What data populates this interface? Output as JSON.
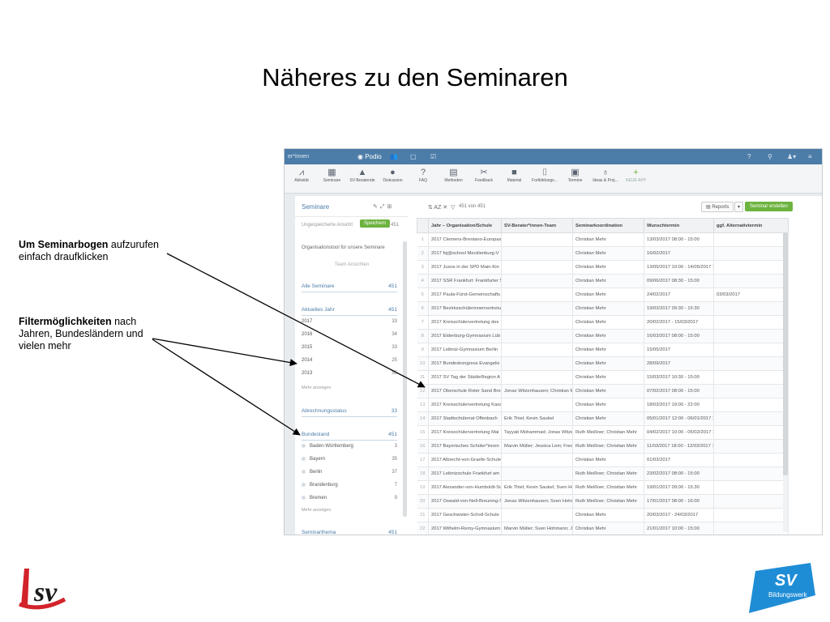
{
  "slide": {
    "title": "Näheres zu den Seminaren",
    "callout1_bold": "Um Seminarbogen",
    "callout1_rest": " aufzurufen",
    "callout1_line2": "einfach draufklicken",
    "callout2_bold": "Filtermöglichkeiten",
    "callout2_rest": " nach",
    "callout2_line2": "Jahren, Bundesländern und",
    "callout2_line3": "vielen mehr"
  },
  "app": {
    "workspace": "er*innen",
    "logo": "Podio",
    "toolbar": [
      {
        "label": "Aktivität",
        "icon": "activity-icon",
        "glyph": "⩘"
      },
      {
        "label": "Seminare",
        "icon": "grid-icon",
        "glyph": "▦"
      },
      {
        "label": "SV-Beratende",
        "icon": "cap-icon",
        "glyph": "▲"
      },
      {
        "label": "Diskussion",
        "icon": "chat-icon",
        "glyph": "●"
      },
      {
        "label": "FAQ",
        "icon": "question-icon",
        "glyph": "?"
      },
      {
        "label": "Methoden",
        "icon": "document-icon",
        "glyph": "▤"
      },
      {
        "label": "Feedback",
        "icon": "tools-icon",
        "glyph": "✂"
      },
      {
        "label": "Material",
        "icon": "folder-icon",
        "glyph": "■"
      },
      {
        "label": "Fortbildungs...",
        "icon": "book-icon",
        "glyph": "⌷"
      },
      {
        "label": "Termine",
        "icon": "calendar-icon",
        "glyph": "▣"
      },
      {
        "label": "Ideas & Proj...",
        "icon": "bulb-icon",
        "glyph": "♁"
      },
      {
        "label": "NEUE APP",
        "icon": "plus-icon",
        "glyph": "+"
      }
    ],
    "sidebar": {
      "title": "Seminare",
      "view_label": "Ungespeicherte Ansicht",
      "save_label": "Speichern",
      "view_count": "451",
      "org_label": "Organisationstool für unsere Seminare",
      "team_label": "Team Ansichten",
      "all_label": "Alle Seminare",
      "all_count": "451",
      "year_label": "Aktuelles Jahr",
      "year_count": "451",
      "years": [
        {
          "label": "2017",
          "count": "33"
        },
        {
          "label": "2016",
          "count": "34"
        },
        {
          "label": "2015",
          "count": "33"
        },
        {
          "label": "2014",
          "count": "25"
        },
        {
          "label": "2013",
          "count": "55"
        }
      ],
      "more1": "Mehr anzeigen",
      "billing_label": "Abrechnungsstatus",
      "billing_count": "33",
      "state_label": "Bundesland",
      "state_count": "451",
      "states": [
        {
          "label": "Baden-Württemberg",
          "count": "3"
        },
        {
          "label": "Bayern",
          "count": "35"
        },
        {
          "label": "Berlin",
          "count": "37"
        },
        {
          "label": "Brandenburg",
          "count": "7"
        },
        {
          "label": "Bremen",
          "count": "9"
        }
      ],
      "more2": "Mehr anzeigen",
      "theme_label": "Seminarthema",
      "theme_count": "451"
    },
    "main": {
      "count_label": "451 von 451",
      "reports_label": "Reports",
      "new_label": "Seminar erstellen",
      "columns": [
        "",
        "Jahr – Organisation/Schule",
        "SV-Berater*innen-Team",
        "Seminarkoordination",
        "Wunschtermin",
        "ggf. Alternativtermin"
      ],
      "rows": [
        [
          "1",
          "2017 Clemens-Brentano-Europas",
          "",
          "Christian Mehr",
          "13/03/2017 08:00 - 15:00",
          ""
        ],
        [
          "2",
          "2017 fsj@school Mecklenburg-V",
          "",
          "Christian Mehr",
          "16/02/2017",
          ""
        ],
        [
          "3",
          "2017 Jusos in der SPD Main-Kin",
          "",
          "Christian Mehr",
          "13/05/2017 10:00 - 14/05/2017 18",
          ""
        ],
        [
          "4",
          "2017 SSR Frankfurt: Frankfurter S",
          "",
          "Christian Mehr",
          "09/06/2017 08:30 - 15:00",
          ""
        ],
        [
          "5",
          "2017 Paula-Fürst-Gemeinschafts",
          "",
          "Christian Mehr",
          "24/02/2017",
          "03/03/2017"
        ],
        [
          "6",
          "2017 Bezirksschülerinnenvertretu",
          "",
          "Christian Mehr",
          "19/03/2017 09:30 - 15:30",
          ""
        ],
        [
          "7",
          "2017 Kreisschülervertretung des",
          "",
          "Christian Mehr",
          "20/02/2017 - 15/03/2017",
          ""
        ],
        [
          "8",
          "2017 Eldenburg-Gymnasium Lüb",
          "",
          "Christian Mehr",
          "16/03/2017 08:00 - 15:00",
          ""
        ],
        [
          "9",
          "2017 Leibniz-Gymnasium Berlin",
          "",
          "Christian Mehr",
          "15/05/2017",
          ""
        ],
        [
          "10",
          "2017 Bundeskongress Evangelis",
          "",
          "Christian Mehr",
          "28/09/2017",
          ""
        ],
        [
          "11",
          "2017 SV Tag der StädteRegion A",
          "",
          "Christian Mehr",
          "15/03/2017 10:30 - 15:00",
          ""
        ],
        [
          "12",
          "2017 Oberschule Roter Sand Bre",
          "Jonas Witzenhausen; Christian M",
          "Christian Mehr",
          "07/02/2017 08:00 - 15:00",
          ""
        ],
        [
          "13",
          "2017 Kreisschülervertretung Kass",
          "",
          "Christian Mehr",
          "18/03/2017 19:00 - 22:00",
          ""
        ],
        [
          "14",
          "2017 Stadtschülerrat Offenbach",
          "Erik Thiel; Kevin Saukel",
          "Christian Mehr",
          "05/01/2017 12:00 - 06/01/2017 13",
          ""
        ],
        [
          "15",
          "2017 Kreisschülervertretung Mai",
          "Tayyab Mohammad; Jonas Witze",
          "Ruth Meißner; Christian Mehr",
          "04/02/2017 10:00 - 05/02/2017 13",
          ""
        ],
        [
          "16",
          "2017 Bayerisches Schüler*innen",
          "Marvin Müller; Jessica Lein; Fred",
          "Ruth Meißner; Christian Mehr",
          "11/03/2017 18:00 - 12/03/2017 14",
          ""
        ],
        [
          "17",
          "2017 Albrecht-von-Graefe-Schule",
          "",
          "Christian Mehr",
          "01/03/2017",
          ""
        ],
        [
          "18",
          "2017 Leibnizschule Frankfurt am",
          "",
          "Ruth Meißner; Christian Mehr",
          "23/02/2017 08:00 - 15:00",
          ""
        ],
        [
          "19",
          "2017 Alexander-von-Humboldt-Sc",
          "Erik Thiel; Kevin Saukel; Sven Ho",
          "Ruth Meißner; Christian Mehr",
          "19/01/2017 09:00 - 15:30",
          ""
        ],
        [
          "20",
          "2017 Oswald-von-Nell-Breuning-S",
          "Jonas Witzenhausen; Sven Hohm",
          "Ruth Meißner; Christian Mehr",
          "17/01/2017 08:00 - 16:00",
          ""
        ],
        [
          "21",
          "2017 Geschwister-Scholl-Schule",
          "",
          "Christian Mehr",
          "20/03/2017 - 24/03/2017",
          ""
        ],
        [
          "22",
          "2017 Wilhelm-Remy-Gymnasium",
          "Marvin Müller; Sven Hohmann; Jc",
          "Christian Mehr",
          "21/01/2017 10:00 - 15:00",
          ""
        ]
      ]
    }
  },
  "logos": {
    "left": "lsv",
    "right_title": "SV",
    "right_sub": "Bildungswerk"
  },
  "colors": {
    "topbar": "#4c7ca8",
    "accent_green": "#6db33f",
    "link_blue": "#4c7ca8",
    "lsv_red": "#d2232a",
    "sv_blue": "#1f8dd6"
  }
}
